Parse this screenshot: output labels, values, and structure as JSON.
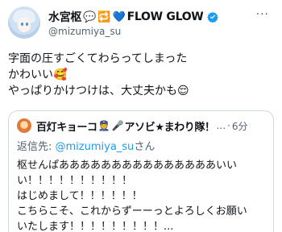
{
  "author": {
    "display_name": "水宮枢",
    "name_emojis": [
      "💬",
      "🔁",
      "💙"
    ],
    "name_suffix": "FLOW GLOW",
    "handle": "@mizumiya_su"
  },
  "more_label": "···",
  "tweet": {
    "lines": [
      "字面の圧すごくてわらってしまった",
      "かわいい🥰",
      "やっぱりかけつけは、大丈夫かも😌"
    ]
  },
  "quote": {
    "display_name_a": "百灯キョーコ",
    "name_emojis": [
      "👮",
      "🎤"
    ],
    "display_name_b": "アソビ★まわり隊！",
    "ellipsis": "...",
    "separator": "·",
    "time": "6分",
    "reply_prefix": "返信先: ",
    "reply_mention": "@mizumiya_su",
    "reply_suffix": "さん",
    "lines": [
      "枢せんぱあああああああああああああああいい",
      "い！！！！！！！！！！",
      "はじめまして！！！！！！",
      "こちらこそ、これからずーーっとよろしくお願い",
      "いたします！！！！！！！！！..."
    ]
  },
  "colors": {
    "text": "#0f1419",
    "muted": "#536471",
    "link": "#1d9bf0",
    "border": "#cfd9de",
    "verified": "#1d9bf0"
  }
}
